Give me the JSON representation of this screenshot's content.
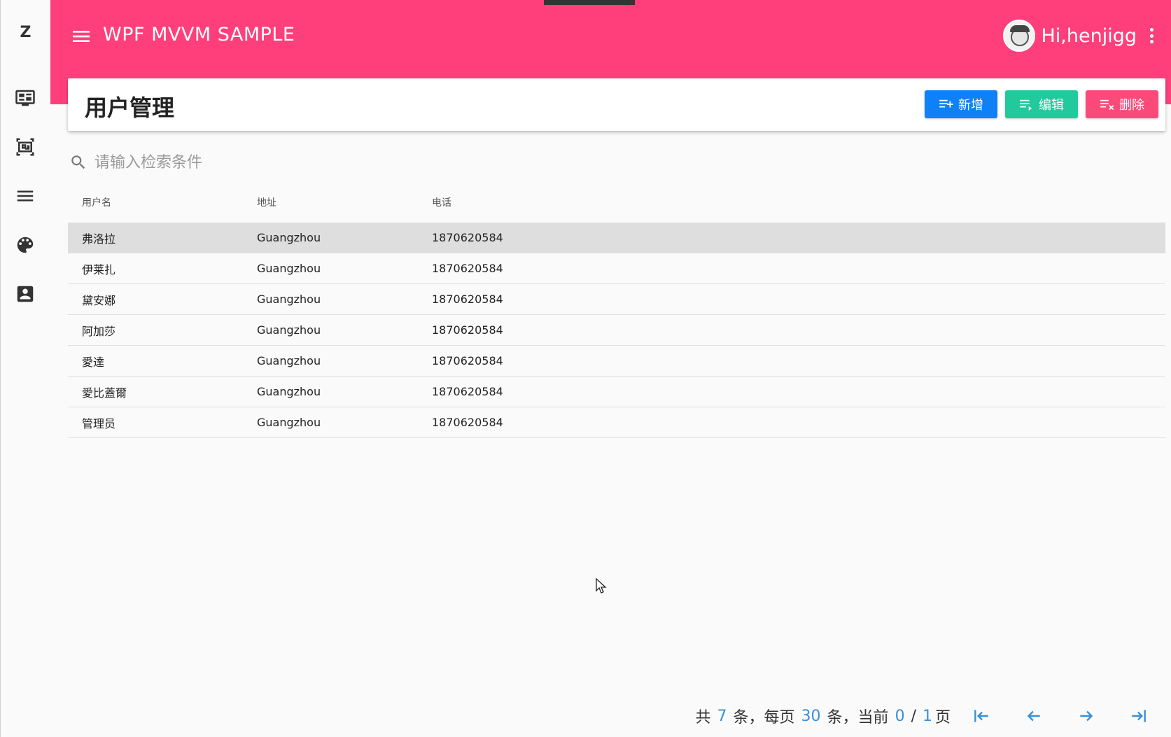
{
  "app": {
    "logo": "Z",
    "title": "WPF MVVM SAMPLE",
    "greeting": "Hi,henjigg"
  },
  "sidebar": {
    "items": [
      {
        "icon": "dashboard-icon"
      },
      {
        "icon": "layers-icon"
      },
      {
        "icon": "menu-list-icon"
      },
      {
        "icon": "palette-icon"
      },
      {
        "icon": "contact-icon"
      }
    ]
  },
  "page": {
    "title": "用户管理",
    "actions": {
      "add": "新增",
      "edit": "编辑",
      "delete": "删除"
    }
  },
  "search": {
    "placeholder": "请输入检索条件",
    "value": ""
  },
  "table": {
    "columns": [
      "用户名",
      "地址",
      "电话"
    ],
    "rows": [
      {
        "name": "弗洛拉",
        "address": "Guangzhou",
        "phone": "1870620584",
        "selected": true
      },
      {
        "name": "伊莱扎",
        "address": "Guangzhou",
        "phone": "1870620584"
      },
      {
        "name": "黛安娜",
        "address": "Guangzhou",
        "phone": "1870620584"
      },
      {
        "name": "阿加莎",
        "address": "Guangzhou",
        "phone": "1870620584"
      },
      {
        "name": "愛達",
        "address": "Guangzhou",
        "phone": "1870620584"
      },
      {
        "name": "愛比蓋爾",
        "address": "Guangzhou",
        "phone": "1870620584"
      },
      {
        "name": "管理员",
        "address": "Guangzhou",
        "phone": "1870620584"
      }
    ]
  },
  "pager": {
    "prefix": "共",
    "total": "7",
    "mid1": "条，每页",
    "per_page": "30",
    "mid2": "条，当前",
    "current": "0",
    "slash": "/",
    "pages": "1",
    "suffix": "页"
  },
  "colors": {
    "appbar": "#ff3f7c",
    "add": "#0f80f5",
    "edit": "#22c99c",
    "delete": "#fa4a79",
    "accent": "#3b8fd8"
  }
}
